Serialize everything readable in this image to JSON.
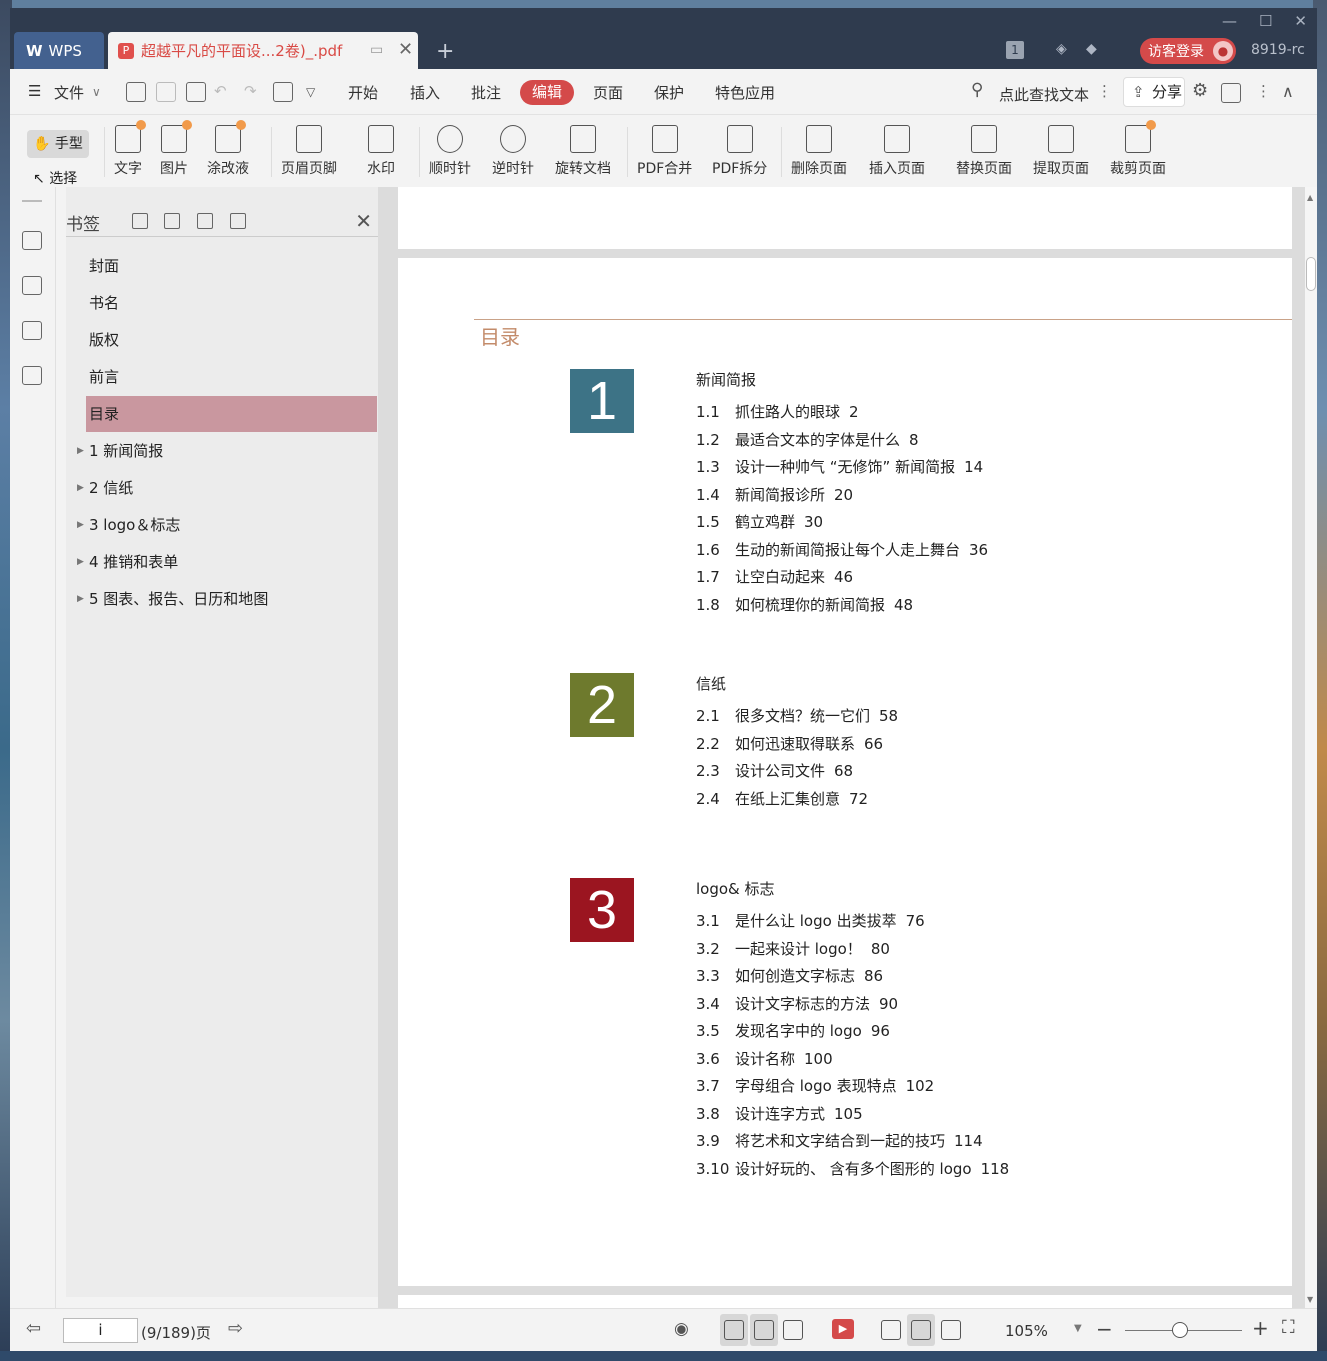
{
  "titlebar": {
    "wps_label": "WPS",
    "doc_tab_title": "超越平凡的平面设...2卷)_.pdf",
    "login_label": "访客登录",
    "username": "8919-rc",
    "page_badge": "1"
  },
  "menu": {
    "file": "文件",
    "items": [
      "开始",
      "插入",
      "批注",
      "编辑",
      "页面",
      "保护",
      "特色应用"
    ],
    "search": "点此查找文本",
    "share": "分享"
  },
  "toolbar": {
    "hand": "手型",
    "select": "选择",
    "tools": [
      "文字",
      "图片",
      "涂改液",
      "页眉页脚",
      "水印",
      "顺时针",
      "逆时针",
      "旋转文档",
      "PDF合并",
      "PDF拆分",
      "删除页面",
      "插入页面",
      "替换页面",
      "提取页面",
      "裁剪页面"
    ]
  },
  "bookmarks": {
    "title": "书签",
    "items": [
      {
        "label": "封面",
        "expandable": false,
        "selected": false
      },
      {
        "label": "书名",
        "expandable": false,
        "selected": false
      },
      {
        "label": "版权",
        "expandable": false,
        "selected": false
      },
      {
        "label": "前言",
        "expandable": false,
        "selected": false
      },
      {
        "label": "目录",
        "expandable": false,
        "selected": true
      },
      {
        "label": "1 新闻简报",
        "expandable": true,
        "selected": false
      },
      {
        "label": "2 信纸",
        "expandable": true,
        "selected": false
      },
      {
        "label": "3 logo＆标志",
        "expandable": true,
        "selected": false
      },
      {
        "label": "4 推销和表单",
        "expandable": true,
        "selected": false
      },
      {
        "label": "5 图表、报告、日历和地图",
        "expandable": true,
        "selected": false
      }
    ]
  },
  "toc": {
    "title": "目录",
    "sections": [
      {
        "number": "1",
        "color": "#3d7386",
        "title": "新闻简报",
        "entries": [
          {
            "num": "1.1",
            "text": "抓住路人的眼球",
            "page": "2"
          },
          {
            "num": "1.2",
            "text": "最适合文本的字体是什么",
            "page": "8"
          },
          {
            "num": "1.3",
            "text": "设计一种帅气 “无修饰” 新闻简报",
            "page": "14"
          },
          {
            "num": "1.4",
            "text": "新闻简报诊所",
            "page": "20"
          },
          {
            "num": "1.5",
            "text": "鹤立鸡群",
            "page": "30"
          },
          {
            "num": "1.6",
            "text": "生动的新闻简报让每个人走上舞台",
            "page": "36"
          },
          {
            "num": "1.7",
            "text": "让空白动起来",
            "page": "46"
          },
          {
            "num": "1.8",
            "text": "如何梳理你的新闻简报",
            "page": "48"
          }
        ]
      },
      {
        "number": "2",
        "color": "#6e7a2d",
        "title": "信纸",
        "entries": [
          {
            "num": "2.1",
            "text": "很多文档？统一它们",
            "page": "58"
          },
          {
            "num": "2.2",
            "text": "如何迅速取得联系",
            "page": "66"
          },
          {
            "num": "2.3",
            "text": "设计公司文件",
            "page": "68"
          },
          {
            "num": "2.4",
            "text": "在纸上汇集创意",
            "page": "72"
          }
        ]
      },
      {
        "number": "3",
        "color": "#9b1520",
        "title": "logo& 标志",
        "entries": [
          {
            "num": "3.1",
            "text": "是什么让 logo 出类拔萃",
            "page": "76"
          },
          {
            "num": "3.2",
            "text": "一起来设计 logo！",
            "page": "80"
          },
          {
            "num": "3.3",
            "text": "如何创造文字标志",
            "page": "86"
          },
          {
            "num": "3.4",
            "text": "设计文字标志的方法",
            "page": "90"
          },
          {
            "num": "3.5",
            "text": "发现名字中的 logo",
            "page": "96"
          },
          {
            "num": "3.6",
            "text": "设计名称",
            "page": "100"
          },
          {
            "num": "3.7",
            "text": "字母组合 logo 表现特点",
            "page": "102"
          },
          {
            "num": "3.8",
            "text": "设计连字方式",
            "page": "105"
          },
          {
            "num": "3.9",
            "text": "将艺术和文字结合到一起的技巧",
            "page": "114"
          },
          {
            "num": "3.10",
            "text": "设计好玩的、 含有多个图形的 logo",
            "page": "118"
          }
        ]
      }
    ]
  },
  "status": {
    "page_input": "i",
    "page_info": "(9/189)页",
    "zoom": "105%"
  }
}
